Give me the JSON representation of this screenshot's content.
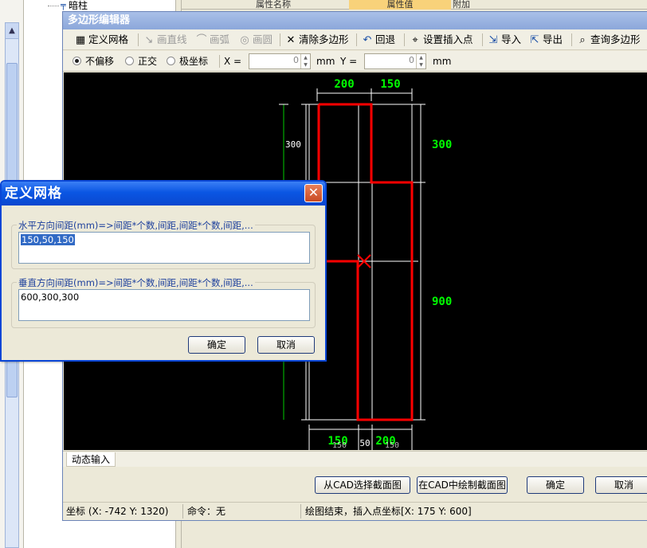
{
  "background": {
    "tree_item": "暗柱",
    "header_col1": "属性名称",
    "header_col2": "属性值",
    "header_col3": "附加"
  },
  "editor": {
    "title": "多边形编辑器",
    "toolbar": {
      "define_grid": "定义网格",
      "draw_line": "画直线",
      "draw_arc": "画弧",
      "draw_circle": "画圆",
      "clear_polygon": "清除多边形",
      "undo": "回退",
      "set_insert_point": "设置插入点",
      "import": "导入",
      "export": "导出",
      "query_polygon": "查询多边形"
    },
    "options": {
      "no_offset": "不偏移",
      "orthogonal": "正交",
      "polar": "极坐标",
      "x_label": "X =",
      "x_value": "0",
      "x_unit": "mm",
      "y_label": "Y =",
      "y_value": "0",
      "y_unit": "mm"
    },
    "canvas": {
      "dim_top_left": "200",
      "dim_top_right": "150",
      "dim_right_upper": "300",
      "dim_right_lower": "900",
      "dim_left_small": "300",
      "dim_bottom_left": "150",
      "dim_bottom_mid": "50",
      "dim_bottom_right": "200",
      "dim_bottom_left_small": "150",
      "dim_bottom_right_small": "150",
      "colors": {
        "polygon": "#ff0000",
        "dimension": "#00ff00",
        "grid": "#ffffff"
      }
    },
    "dynamic_input_tab": "动态输入",
    "buttons": {
      "select_from_cad": "从CAD选择截面图",
      "draw_in_cad": "在CAD中绘制截面图",
      "ok": "确定",
      "cancel": "取消"
    },
    "status": {
      "coords": "坐标 (X: -742 Y: 1320)",
      "command": "命令：无",
      "message": "绘图结束，插入点坐标[X: 175 Y: 600]"
    }
  },
  "grid_dialog": {
    "title": "定义网格",
    "close": "✕",
    "horizontal_label": "水平方向间距(mm)=>间距*个数,间距,间距*个数,间距,...",
    "horizontal_value": "150,50,150",
    "vertical_label": "垂直方向间距(mm)=>间距*个数,间距,间距*个数,间距,...",
    "vertical_value": "600,300,300",
    "ok": "确定",
    "cancel": "取消"
  }
}
